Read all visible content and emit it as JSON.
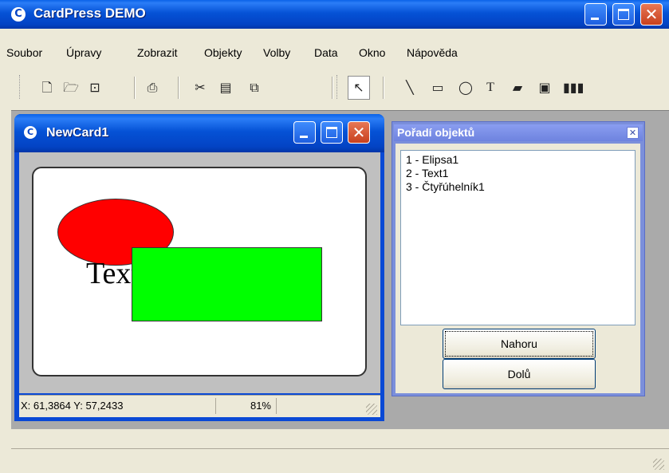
{
  "app": {
    "title": "CardPress DEMO",
    "icon_letter": "C",
    "accent_color": "#0553d6"
  },
  "menu": [
    "Soubor",
    "Úpravy",
    "Zobrazit",
    "Objekty",
    "Volby",
    "Data",
    "Okno",
    "Nápověda"
  ],
  "toolbar": {
    "file": [
      "new-file-icon",
      "open-file-icon",
      "save-file-icon"
    ],
    "print": [
      "print-icon"
    ],
    "edit": [
      "cut-icon",
      "copy-icon",
      "paste-icon"
    ],
    "tools": [
      "select-arrow-icon",
      "line-tool-icon",
      "rectangle-tool-icon",
      "ellipse-tool-icon",
      "text-tool-icon",
      "image-tool-icon",
      "picture-frame-tool-icon",
      "barcode-tool-icon"
    ],
    "text_tool_glyph": "T"
  },
  "child_window": {
    "title": "NewCard1",
    "icon_letter": "C",
    "canvas": {
      "ellipse_color": "#ff0000",
      "rectangle_color": "#00ff00",
      "text_object": "Text1"
    },
    "status": {
      "coords": "X: 61,3864 Y: 57,2433",
      "zoom": "81%"
    }
  },
  "order_panel": {
    "title": "Pořadí objektů",
    "items": [
      "1 - Elipsa1",
      "2 - Text1",
      "3 - Čtyřúhelník1"
    ],
    "up_button": "Nahoru",
    "down_button": "Dolů"
  }
}
